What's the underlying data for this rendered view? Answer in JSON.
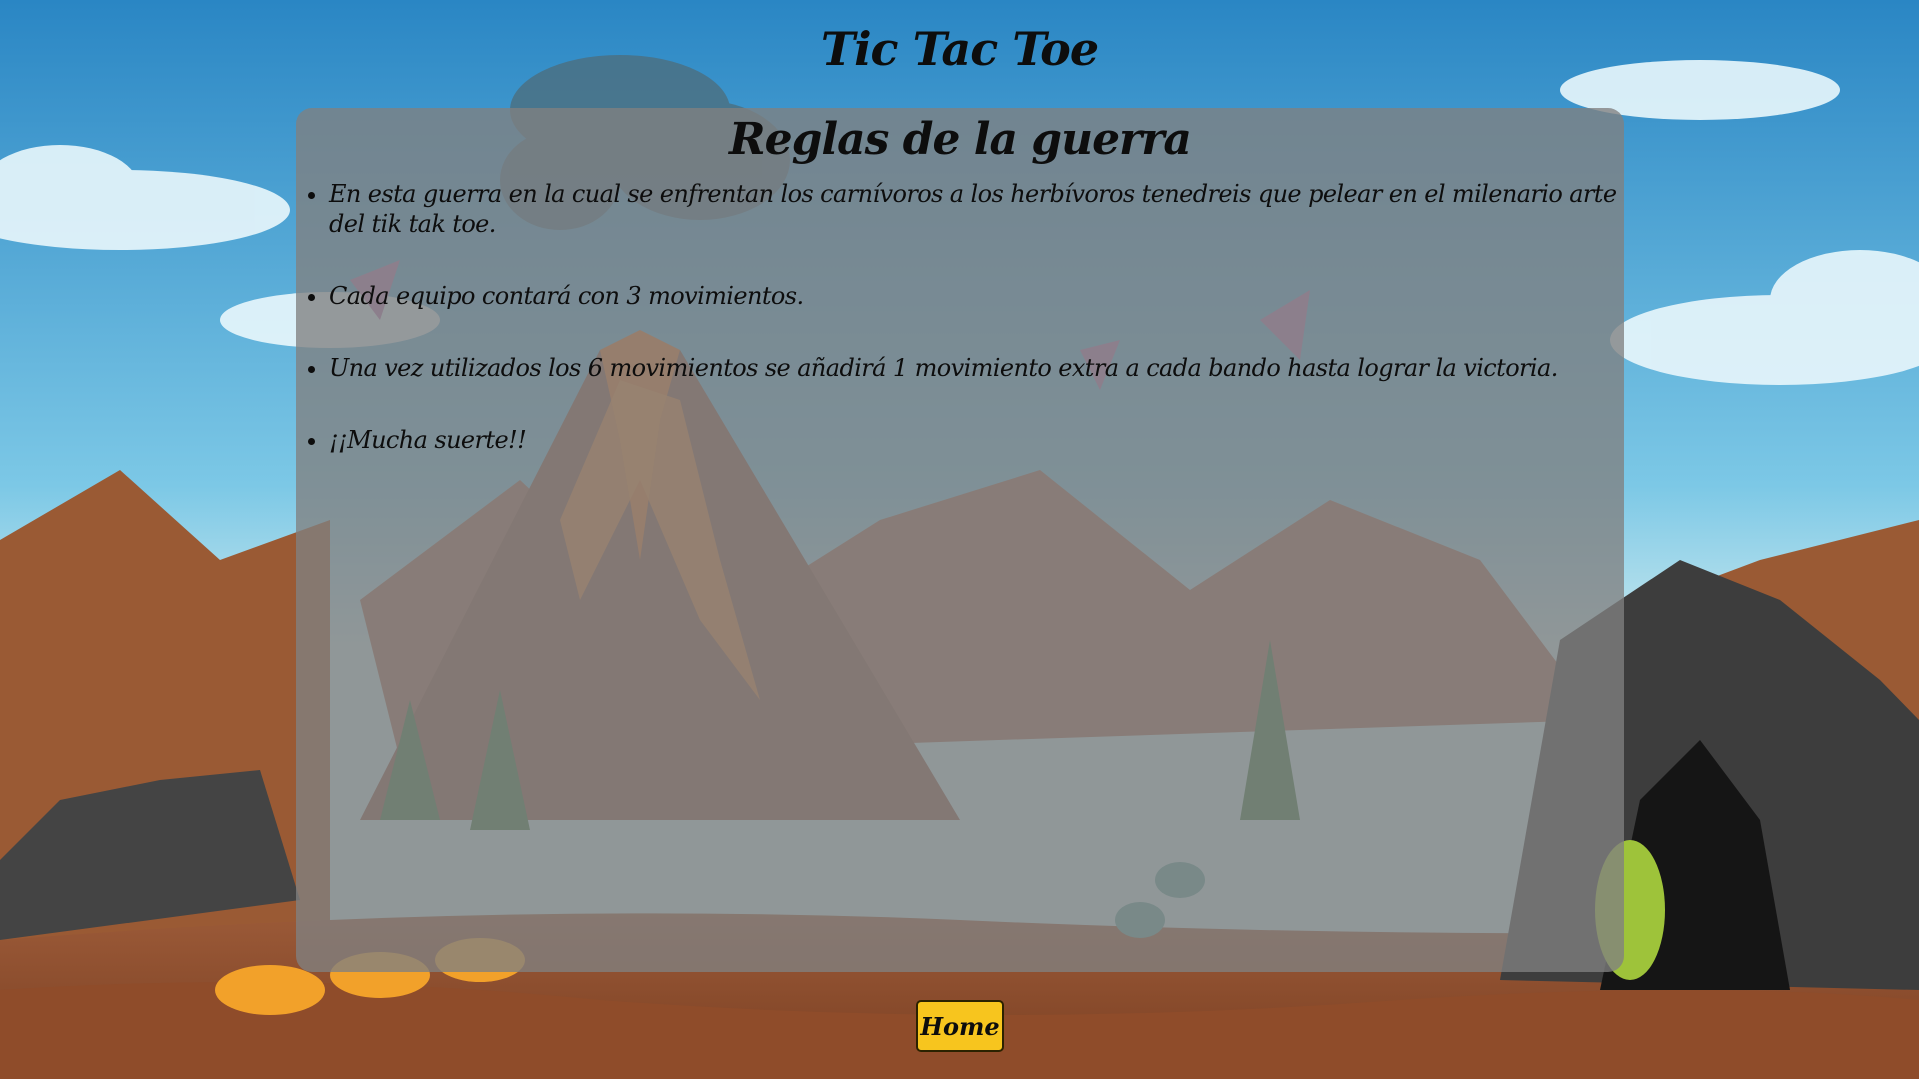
{
  "page": {
    "title": "Tic Tac Toe"
  },
  "rules": {
    "heading": "Reglas de la guerra",
    "items": [
      "En esta guerra en la cual se enfrentan los carnívoros a los herbívoros tenedreis que pelear en el milenario arte del tik tak toe.",
      "Cada equipo contará con 3 movimientos.",
      "Una vez utilizados los 6 movimientos se añadirá 1 movimiento extra a cada bando hasta lograr la victoria.",
      "¡¡Mucha suerte!!"
    ]
  },
  "actions": {
    "home_label": "Home"
  },
  "colors": {
    "sky_top": "#2a86c4",
    "sky_bottom": "#9fdcf0",
    "ground": "#8a4a2c",
    "panel": "#808080",
    "button": "#f7c51e"
  }
}
